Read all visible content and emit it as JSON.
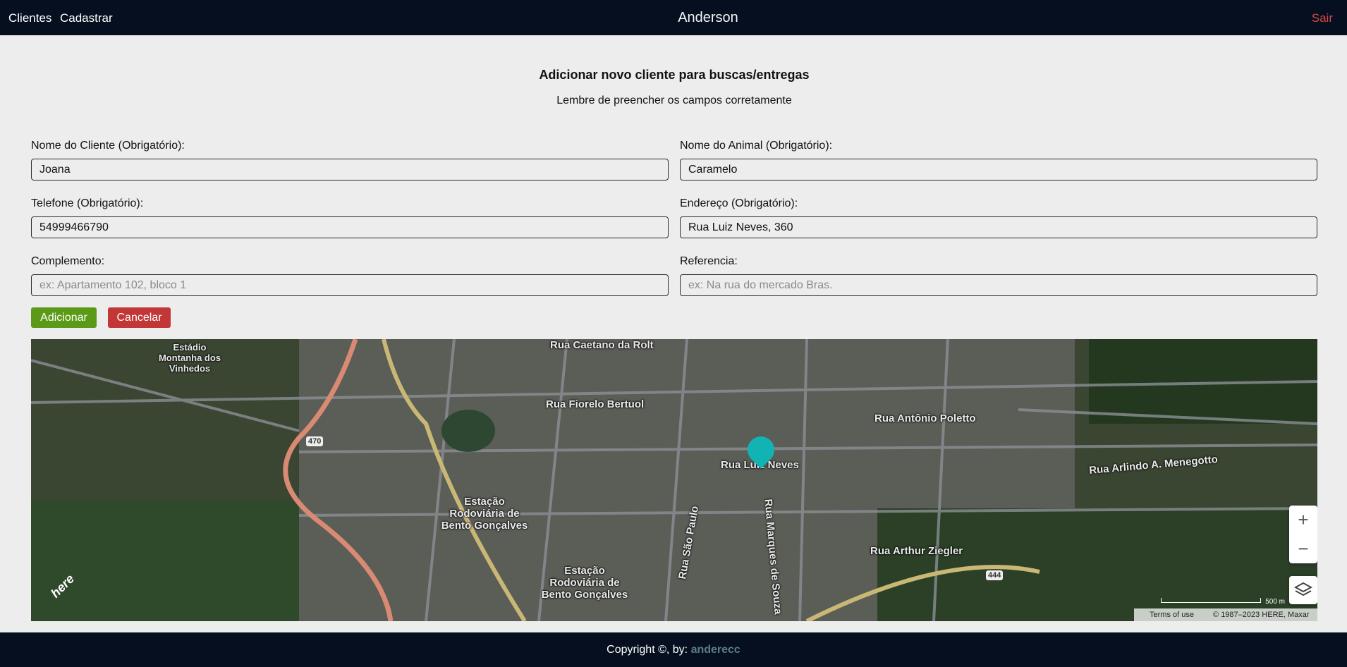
{
  "nav": {
    "clientes": "Clientes",
    "cadastrar": "Cadastrar",
    "brand": "Anderson",
    "sair": "Sair"
  },
  "header": {
    "title": "Adicionar novo cliente para buscas/entregas",
    "subtitle": "Lembre de preencher os campos corretamente"
  },
  "form": {
    "nome_cliente": {
      "label": "Nome do Cliente (Obrigatório):",
      "value": "Joana"
    },
    "nome_animal": {
      "label": "Nome do Animal (Obrigatório):",
      "value": "Caramelo"
    },
    "telefone": {
      "label": "Telefone (Obrigatório):",
      "value": "54999466790"
    },
    "endereco": {
      "label": "Endereço (Obrigatório):",
      "value": "Rua Luiz Neves, 360"
    },
    "complemento": {
      "label": "Complemento:",
      "value": "",
      "placeholder": "ex: Apartamento 102, bloco 1"
    },
    "referencia": {
      "label": "Referencia:",
      "value": "",
      "placeholder": "ex: Na rua do mercado Bras."
    },
    "add_label": "Adicionar",
    "cancel_label": "Cancelar"
  },
  "map": {
    "streets": [
      "Rua Caetano da Rolt",
      "Rua Fiorelo Bertuol",
      "Rua Antônio Poletto",
      "Rua Luiz Neves",
      "Rua Arlindo A. Menegotto",
      "Estação Rodoviária de Bento Gonçalves",
      "Rua São Paulo",
      "Rua Marques de Souza",
      "Rua Arthur Ziegler",
      "Estação Rodoviária de Bento Gonçalves",
      "Estádio Montanha dos Vinhedos"
    ],
    "route_shields": [
      "470",
      "444"
    ],
    "zoom_in": "+",
    "zoom_out": "−",
    "logo": "here",
    "scale": "500 m",
    "terms": "Terms of use",
    "copyright": "© 1987–2023 HERE, Maxar",
    "marker_color": "#12b3b3",
    "icons": [
      "plus-icon",
      "minus-icon",
      "layers-icon",
      "map-marker-icon"
    ]
  },
  "footer": {
    "text": "Copyright ©, by:",
    "author": "anderecc"
  }
}
